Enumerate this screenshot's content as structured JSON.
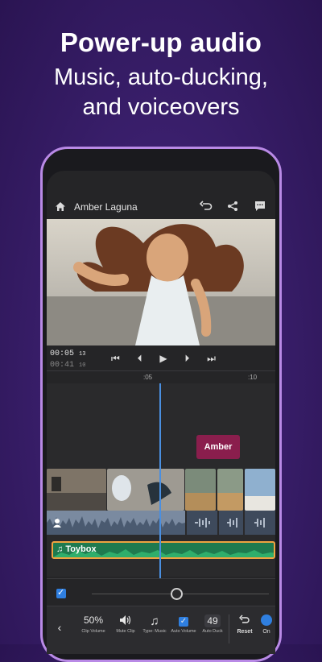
{
  "promo": {
    "title": "Power-up audio",
    "subtitle_line1": "Music, auto-ducking,",
    "subtitle_line2": "and voiceovers"
  },
  "app": {
    "project_title": "Amber Laguna",
    "icons": [
      "home-icon",
      "undo-icon",
      "share-icon",
      "comment-icon"
    ]
  },
  "playback": {
    "current_time": "00:05",
    "current_frames": "13",
    "total_time": "00:41",
    "total_frames": "10"
  },
  "ruler": {
    "tick1": ":05",
    "tick2": ":10"
  },
  "timeline": {
    "title_clip": "Amber",
    "music_clip": "Toybox",
    "playhead_fraction": 0.49
  },
  "audio_tools": {
    "clip_volume_value": "50%",
    "clip_volume_label": "Clip Volume",
    "mute_clip_label": "Mute Clip",
    "type_music_label": "Type: Music",
    "auto_volume_label": "Auto Volume",
    "auto_duck_value": "49",
    "auto_duck_label": "Auto Duck",
    "reset_label": "Reset",
    "toggle_label": "On"
  },
  "colors": {
    "accent": "#2f7fe0",
    "title_clip": "#8a1e4d",
    "music_clip": "#1f7a4f",
    "music_border": "#f0a340",
    "phone_frame": "#b98ae6"
  }
}
